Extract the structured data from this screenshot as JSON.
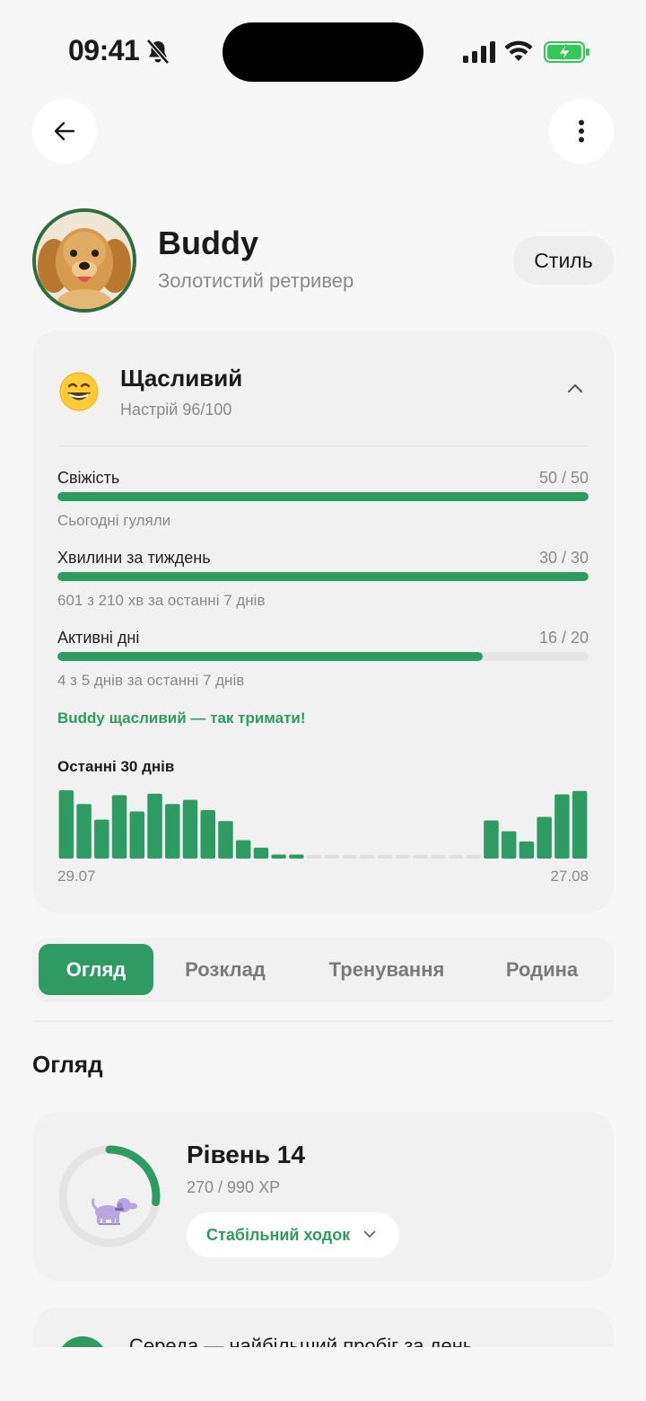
{
  "status_bar": {
    "time": "09:41",
    "icons": [
      "bell-muted-icon",
      "signal-icon",
      "wifi-icon",
      "battery-charging-icon"
    ]
  },
  "nav": {
    "back_icon": "arrow-left-icon",
    "menu_icon": "more-vertical-icon"
  },
  "profile": {
    "name": "Buddy",
    "breed": "Золотистий ретривер",
    "style_button": "Стиль"
  },
  "mood": {
    "emoji": "grinning-face-icon",
    "title": "Щасливий",
    "subtitle": "Настрій 96/100",
    "metrics": [
      {
        "label": "Свіжість",
        "value": "50 / 50",
        "fraction": 1.0,
        "note": "Сьогодні гуляли"
      },
      {
        "label": "Хвилини за тиждень",
        "value": "30 / 30",
        "fraction": 1.0,
        "note": "601 з 210 хв за останні 7 днів"
      },
      {
        "label": "Активні дні",
        "value": "16 / 20",
        "fraction": 0.8,
        "note": "4 з 5 днів за останні 7 днів"
      }
    ],
    "happy_note": "Buddy щасливий — так тримати!",
    "chart_title": "Останні 30 днів",
    "date_start": "29.07",
    "date_end": "27.08"
  },
  "chart_data": {
    "type": "bar",
    "title": "Останні 30 днів",
    "x_start": "29.07",
    "x_end": "27.08",
    "values": [
      100,
      80,
      57,
      93,
      69,
      95,
      80,
      86,
      71,
      55,
      27,
      16,
      6,
      6,
      0,
      0,
      0,
      0,
      0,
      0,
      0,
      0,
      0,
      0,
      56,
      40,
      25,
      61,
      94,
      99
    ],
    "colors": {
      "bar": "#2e9b63",
      "empty": "#e0e0e0"
    }
  },
  "tabs": {
    "items": [
      "Огляд",
      "Розклад",
      "Тренування",
      "Родина"
    ],
    "active": "Огляд"
  },
  "overview": {
    "section_title": "Огляд",
    "level_title": "Рівень 14",
    "xp": "270 / 990 XP",
    "xp_fraction": 0.27,
    "badge": "Стабільний ходок",
    "next_text": "Середа — найбільший пробіг за день"
  },
  "colors": {
    "accent": "#2e9b63",
    "avatar_border": "#2f6e3c",
    "background": "#f7f7f7",
    "card": "#f1f1f1"
  }
}
